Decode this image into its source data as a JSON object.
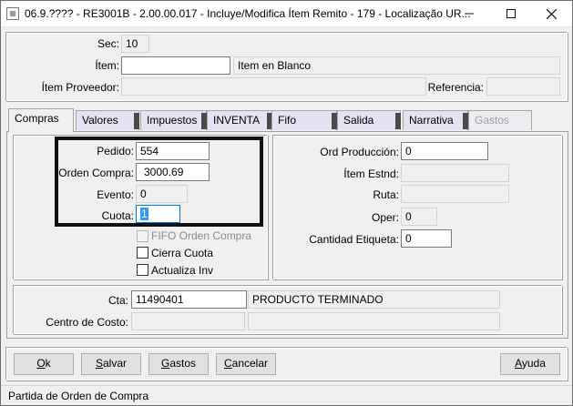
{
  "window": {
    "title": "06.9.???? - RE3001B - 2.00.00.017 - Incluye/Modifica Ítem Remito - 179 - Localização UR..."
  },
  "header": {
    "sec_label": "Sec:",
    "sec_value": "10",
    "item_label": "Ítem:",
    "item_value": "",
    "item_desc": "Item en Blanco",
    "proveedor_label": "Ítem Proveedor:",
    "proveedor_value": "",
    "referencia_label": "Referencia:",
    "referencia_value": ""
  },
  "tabs": [
    {
      "label": "Compras",
      "state": "active"
    },
    {
      "label": "Valores",
      "state": "normal"
    },
    {
      "label": "Impuestos",
      "state": "normal"
    },
    {
      "label": "INVENTA",
      "state": "normal"
    },
    {
      "label": "Fifo",
      "state": "normal"
    },
    {
      "label": "Salida",
      "state": "normal"
    },
    {
      "label": "Narrativa",
      "state": "normal"
    },
    {
      "label": "Gastos",
      "state": "disabled"
    }
  ],
  "compras": {
    "pedido_label": "Pedido:",
    "pedido_value": "554",
    "orden_compra_label": "Orden Compra:",
    "orden_compra_value": "3000.69",
    "evento_label": "Evento:",
    "evento_value": "0",
    "cuota_label": "Cuota:",
    "cuota_value": "1",
    "fifo_orden_compra_label": "FIFO Orden Compra",
    "fifo_orden_compra_checked": false,
    "cierra_cuota_label": "Cierra Cuota",
    "cierra_cuota_checked": false,
    "actualiza_inv_label": "Actualiza Inv",
    "actualiza_inv_checked": false,
    "ord_produccion_label": "Ord Producción:",
    "ord_produccion_value": "0",
    "item_estnd_label": "Ítem Estnd:",
    "item_estnd_value": "",
    "ruta_label": "Ruta:",
    "ruta_value": "",
    "oper_label": "Oper:",
    "oper_value": "0",
    "cantidad_etiqueta_label": "Cantidad Etiqueta:",
    "cantidad_etiqueta_value": "0",
    "cta_label": "Cta:",
    "cta_value": "11490401",
    "cta_desc": "PRODUCTO TERMINADO",
    "centro_costo_label": "Centro de Costo:",
    "centro_costo_value": "",
    "centro_costo_desc": ""
  },
  "buttons": {
    "ok": {
      "mnemonic": "O",
      "rest": "k"
    },
    "salvar": {
      "mnemonic": "S",
      "rest": "alvar"
    },
    "gastos": {
      "mnemonic": "G",
      "rest": "astos"
    },
    "cancelar": {
      "mnemonic": "C",
      "rest": "ancelar"
    },
    "ayuda": {
      "mnemonic": "A",
      "rest": "yuda"
    }
  },
  "status": {
    "text": "Partida de Orden de Compra"
  },
  "colors": {
    "highlight_border": "#111111",
    "selection": "#3399ff",
    "tab_inactive_bg": "#e3e3f3"
  },
  "icons": [
    "app-icon",
    "minimize-icon",
    "maximize-icon",
    "close-icon"
  ]
}
